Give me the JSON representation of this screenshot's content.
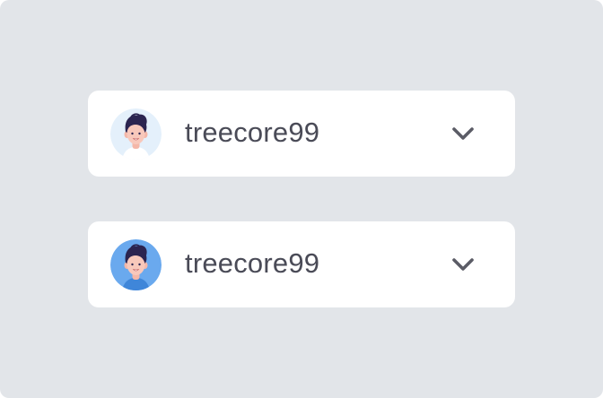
{
  "account_selectors": [
    {
      "username": "treecore99",
      "avatar_background": "#e4f0fb",
      "state": "default"
    },
    {
      "username": "treecore99",
      "avatar_background": "#6aa9ee",
      "state": "highlighted"
    }
  ],
  "colors": {
    "canvas": "#e2e5e9",
    "card": "#ffffff",
    "text": "#4a4b57",
    "chevron": "#5b5c66"
  },
  "icons": [
    "avatar-icon",
    "chevron-down-icon"
  ]
}
